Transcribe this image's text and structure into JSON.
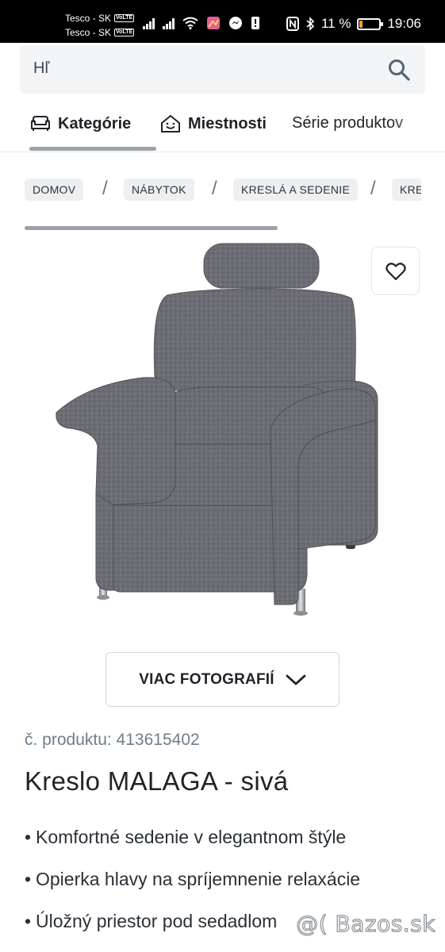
{
  "status_bar": {
    "carrier_1": "Tesco - SK",
    "carrier_2": "Tesco - SK",
    "volte": "VoLTE",
    "battery": "11 %",
    "time": "19:06"
  },
  "search": {
    "value": "Hľ"
  },
  "tabs": [
    {
      "label": "Kategórie",
      "icon": "sofa-icon"
    },
    {
      "label": "Miestnosti",
      "icon": "room-icon"
    },
    {
      "label": "Série produktov"
    }
  ],
  "breadcrumb": [
    "DOMOV",
    "NÁBYTOK",
    "KRESLÁ A SEDENIE",
    "KRE"
  ],
  "product": {
    "more_photos_label": "VIAC FOTOGRAFIÍ",
    "number_text": "č. produktu: 413615402",
    "title": "Kreslo MALAGA - sivá",
    "features": [
      "Komfortné sedenie v elegantnom štýle",
      "Opierka hlavy na spríjemnenie relaxácie",
      "Úložný priestor pod sedadlom"
    ]
  },
  "watermark": "@( Bazos.sk",
  "colors": {
    "chair_fabric": "#6b6b73",
    "accent_grey": "#9aa1a8",
    "battery_low": "#f5a623"
  }
}
